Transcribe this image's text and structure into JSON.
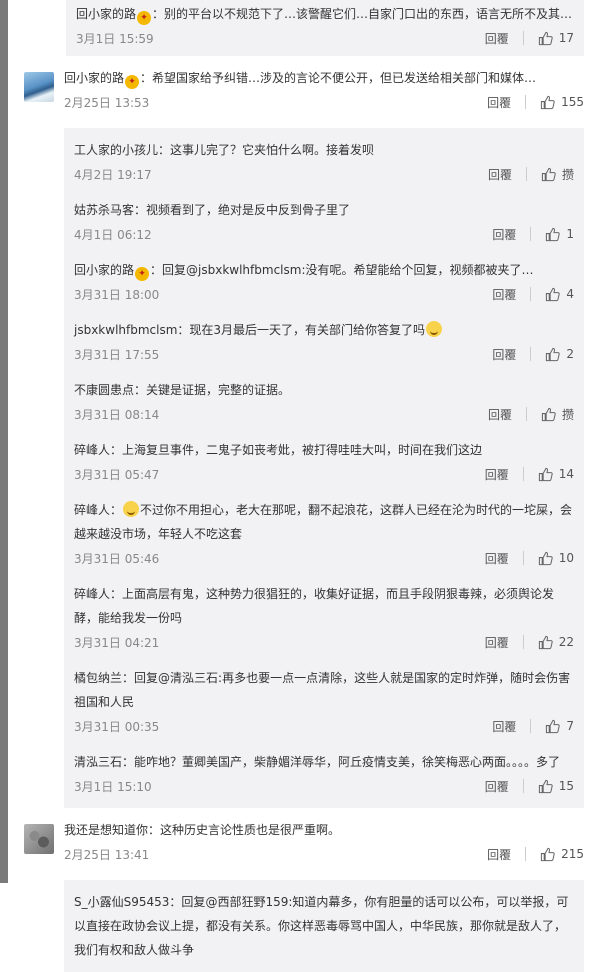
{
  "first_reply": {
    "user": "回小家的路",
    "badge_icon": "vip-badge-icon",
    "text": "：别的平台以不规范下了…该警醒它们…自家门口出的东西，语言无所不及其…",
    "date": "3月1日 15:59",
    "reply_label": "回覆",
    "likes": "17"
  },
  "comments": [
    {
      "avatar_icon": "mountain-landscape-avatar",
      "user": "回小家的路",
      "badge_icon": "vip-badge-icon",
      "text": "：希望国家给予纠错…涉及的言论不便公开，但已发送给相关部门和媒体…",
      "date": "2月25日 13:53",
      "reply_label": "回覆",
      "likes": "155",
      "replies": [
        {
          "user": "工人家的小孩儿",
          "text": "：这事儿完了？它夹怕什么啊。接着发呗",
          "date": "4月2日 19:17",
          "reply_label": "回覆",
          "likes": "攒"
        },
        {
          "user": "姑苏杀马客",
          "text": "：视频看到了，绝对是反中反到骨子里了",
          "date": "4月1日 06:12",
          "reply_label": "回覆",
          "likes": "1"
        },
        {
          "user": "回小家的路",
          "badge_icon": "vip-badge-icon",
          "text_pre": "：回复",
          "mention": "@jsbxkwlhfbmclsm",
          "text": ":没有呢。希望能给个回复，视频都被夹了…",
          "date": "3月31日 18:00",
          "reply_label": "回覆",
          "likes": "4"
        },
        {
          "user": "jsbxkwlhfbmclsm",
          "text": "：现在3月最后一天了，有关部门给你答复了吗",
          "emoji": "confused-face-emoji",
          "date": "3月31日 17:55",
          "reply_label": "回覆",
          "likes": "2"
        },
        {
          "user": "不康圆患点",
          "text": "：关键是证据，完整的证据。",
          "date": "3月31日 08:14",
          "reply_label": "回覆",
          "likes": "攒"
        },
        {
          "user": "碎峰人",
          "text": "：上海复旦事件，二鬼子如丧考妣，被打得哇哇大叫，时间在我们这边",
          "date": "3月31日 05:47",
          "reply_label": "回覆",
          "likes": "14"
        },
        {
          "user": "碎峰人",
          "text_pre": "：",
          "emoji": "grinning-face-emoji",
          "text": "不过你不用担心，老大在那呢，翻不起浪花，这群人已经在沦为时代的一坨屎，会越来越没市场，年轻人不吃这套",
          "date": "3月31日 05:46",
          "reply_label": "回覆",
          "likes": "10"
        },
        {
          "user": "碎峰人",
          "text": "：上面高层有鬼，这种势力很猖狂的，收集好证据，而且手段阴狠毒辣，必须舆论发酵，能给我发一份吗",
          "date": "3月31日 04:21",
          "reply_label": "回覆",
          "likes": "22"
        },
        {
          "user": "橘包纳兰",
          "text_pre": "：回复",
          "mention": "@清泓三石",
          "text": ":再多也要一点一点清除，这些人就是国家的定时炸弹，随时会伤害祖国和人民",
          "date": "3月31日 00:35",
          "reply_label": "回覆",
          "likes": "7"
        },
        {
          "user": "清泓三石",
          "text": "：能咋地？董卿美国产，柴静媚洋辱华，阿丘疫情支美，徐笑梅恶心两面。。。。多了",
          "date": "3月1日 15:10",
          "reply_label": "回覆",
          "likes": "15"
        }
      ]
    },
    {
      "avatar_icon": "blurred-avatar",
      "user": "我还是想知道你",
      "text": "：这种历史言论性质也是很严重啊。",
      "date": "2月25日 13:41",
      "reply_label": "回覆",
      "likes": "215",
      "replies": [
        {
          "user": "S_小露仙S95453",
          "text_pre": "：回复",
          "mention": "@西部狂野159",
          "text": ":知道内幕多，你有胆量的话可以公布，可以举报，可以直接在政协会议上提，都没有关系。你这样恶毒辱骂中国人，中华民族，那你就是敌人了，我们有权和敌人做斗争"
        }
      ]
    }
  ]
}
